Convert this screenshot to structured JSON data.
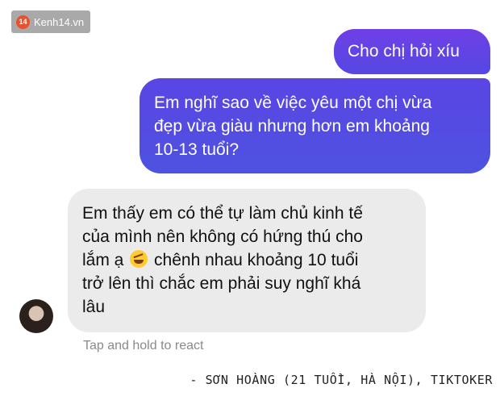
{
  "watermark": {
    "logo": "14",
    "text": "Kenh14.vn"
  },
  "messages": {
    "sent_1": "Cho chị hỏi xíu",
    "sent_2_line1": "Em nghĩ sao về việc yêu một chị vừa",
    "sent_2_line2": "đẹp vừa giàu nhưng hơn em khoảng",
    "sent_2_line3": "10-13 tuổi?",
    "received_line1": "Em thấy em có thể tự làm chủ kinh tế",
    "received_line2": "của mình nên không có hứng thú cho",
    "received_line3a": "lắm ạ",
    "received_emoji": "rolling-on-floor-laughing-emoji",
    "received_line3b": "chênh nhau khoảng 10 tuổi",
    "received_line4": "trở lên thì chắc em phải suy nghĩ khá",
    "received_line5": "lâu"
  },
  "hint": "Tap and hold to react",
  "credit": "- SƠN HOÀNG (21 TUỔI, HÀ NỘI), TIKTOKER",
  "colors": {
    "sent_bubble": "#5b45e4",
    "received_bubble": "#ebebeb",
    "accent_logo": "#e8502f"
  }
}
